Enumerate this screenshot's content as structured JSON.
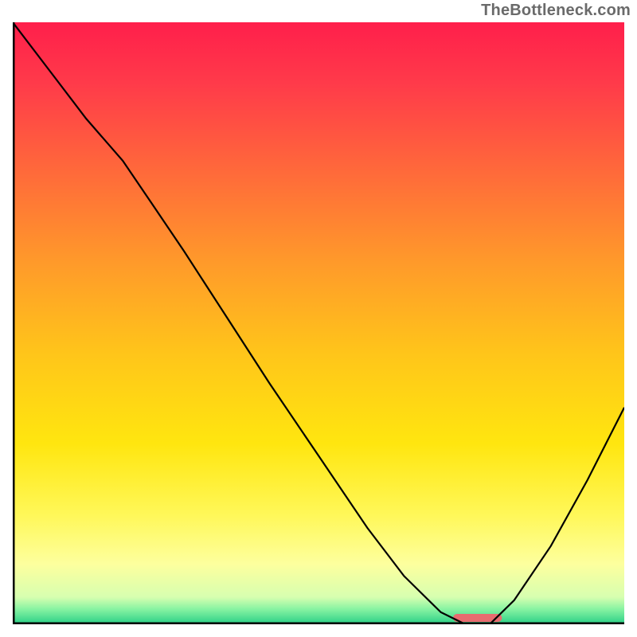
{
  "watermark": "TheBottleneck.com",
  "colors": {
    "curve": "#000000",
    "axis": "#000000",
    "sweet_spot": "#e86b6f",
    "gradient_stops": [
      {
        "offset": 0.0,
        "color": "#ff1f4b"
      },
      {
        "offset": 0.1,
        "color": "#ff3a4a"
      },
      {
        "offset": 0.25,
        "color": "#ff6a3a"
      },
      {
        "offset": 0.4,
        "color": "#ff9a2a"
      },
      {
        "offset": 0.55,
        "color": "#ffc51a"
      },
      {
        "offset": 0.7,
        "color": "#ffe60f"
      },
      {
        "offset": 0.82,
        "color": "#fff85a"
      },
      {
        "offset": 0.9,
        "color": "#fdff9e"
      },
      {
        "offset": 0.955,
        "color": "#d7ffb0"
      },
      {
        "offset": 0.975,
        "color": "#87f3a2"
      },
      {
        "offset": 1.0,
        "color": "#28cf86"
      }
    ]
  },
  "chart_data": {
    "type": "line",
    "title": "",
    "xlabel": "",
    "ylabel": "",
    "xlim": [
      0,
      100
    ],
    "ylim": [
      0,
      100
    ],
    "grid": false,
    "legend": false,
    "axes": {
      "left": true,
      "bottom": true,
      "right": false,
      "top": false
    },
    "series": [
      {
        "name": "bottleneck-curve",
        "x": [
          0,
          6,
          12,
          18,
          22,
          28,
          35,
          42,
          50,
          58,
          64,
          70,
          74,
          78,
          82,
          88,
          94,
          100
        ],
        "y": [
          100,
          92,
          84,
          77,
          71,
          62,
          51,
          40,
          28,
          16,
          8,
          2,
          0,
          0,
          4,
          13,
          24,
          36
        ]
      }
    ],
    "sweet_spot_x_range": [
      72,
      80
    ],
    "sweet_spot_y": 0
  }
}
